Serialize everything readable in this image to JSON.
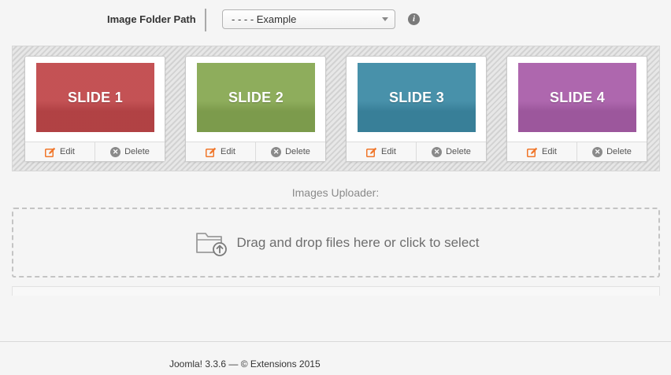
{
  "folder_path": {
    "label": "Image Folder Path",
    "selected": "- - - - Example",
    "info_icon": "info-icon"
  },
  "slides": [
    {
      "title": "SLIDE 1",
      "color": "#c0474a",
      "edit_label": "Edit",
      "delete_label": "Delete"
    },
    {
      "title": "SLIDE 2",
      "color": "#87a852",
      "edit_label": "Edit",
      "delete_label": "Delete"
    },
    {
      "title": "SLIDE 3",
      "color": "#3d8aa5",
      "edit_label": "Edit",
      "delete_label": "Delete"
    },
    {
      "title": "SLIDE 4",
      "color": "#a95ea9",
      "edit_label": "Edit",
      "delete_label": "Delete"
    }
  ],
  "uploader": {
    "title": "Images Uploader:",
    "dropzone_text": "Drag and drop files here or click to select",
    "icon": "folder-upload-icon"
  },
  "footer": {
    "text": "Joomla! 3.3.6  —  © Extensions 2015"
  },
  "colors": {
    "edit_icon": "#f0762a",
    "delete_icon": "#8a8a8a"
  }
}
